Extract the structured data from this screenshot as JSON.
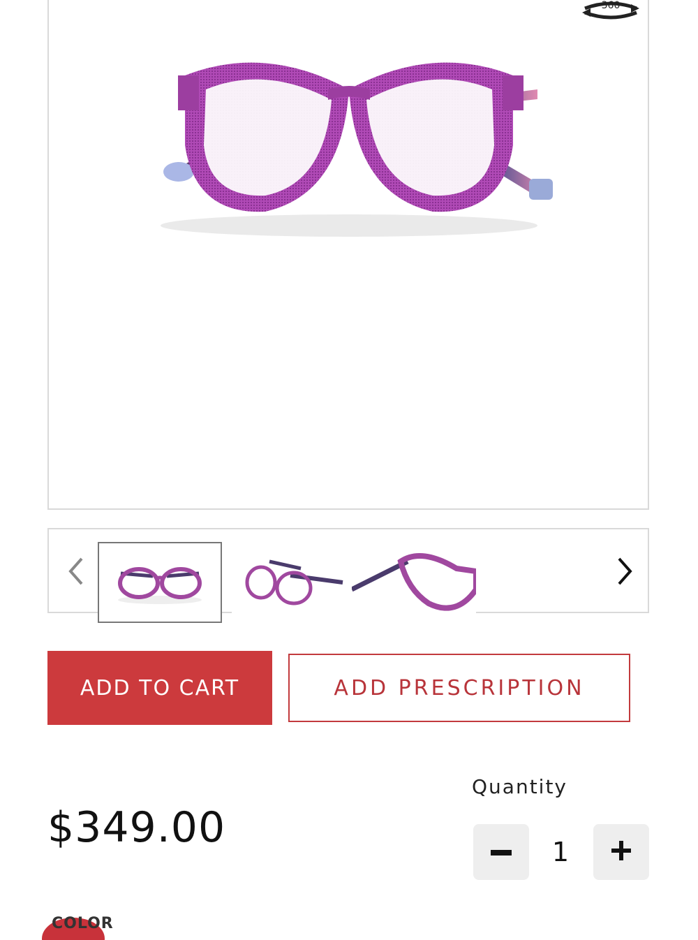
{
  "gallery": {
    "main_image_alt": "Purple cat-eye eyeglasses, front view",
    "view_360_label": "360",
    "thumbnails": [
      {
        "alt": "Front view"
      },
      {
        "alt": "Angled view"
      },
      {
        "alt": "Side view"
      }
    ]
  },
  "actions": {
    "add_to_cart": "ADD TO CART",
    "add_prescription": "ADD PRESCRIPTION"
  },
  "product": {
    "price": "$349.00"
  },
  "quantity": {
    "label": "Quantity",
    "value": "1"
  },
  "color": {
    "label": "COLOR"
  },
  "colors": {
    "accent": "#cc3a3d",
    "frame": "#9c3ea0"
  },
  "icons": {
    "prev": "chevron-left-icon",
    "next": "chevron-right-icon",
    "minus": "minus-icon",
    "plus": "plus-icon",
    "view360": "rotate-360-icon"
  }
}
